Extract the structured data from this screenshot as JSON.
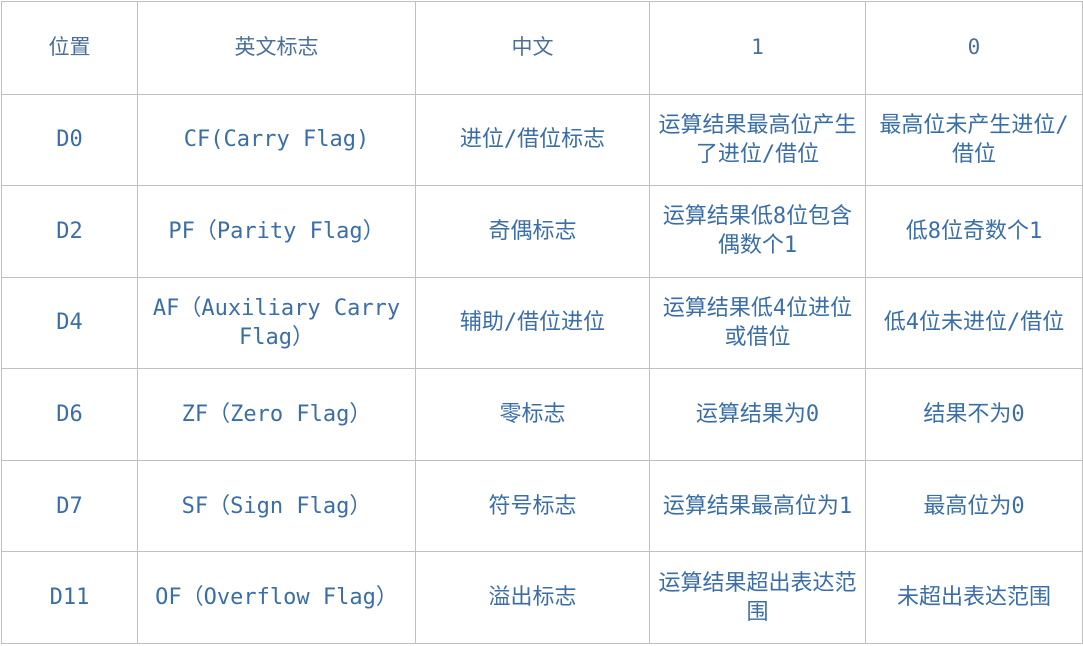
{
  "table": {
    "headers": [
      "位置",
      "英文标志",
      "中文",
      "1",
      "0"
    ],
    "rows": [
      {
        "position": "D0",
        "english": "CF(Carry Flag)",
        "chinese": "进位/借位标志",
        "when_one": "运算结果最高位产生了进位/借位",
        "when_zero": "最高位未产生进位/借位"
      },
      {
        "position": "D2",
        "english": "PF（Parity Flag）",
        "chinese": "奇偶标志",
        "when_one": "运算结果低8位包含偶数个1",
        "when_zero": "低8位奇数个1"
      },
      {
        "position": "D4",
        "english": "AF（Auxiliary Carry Flag）",
        "chinese": "辅助/借位进位",
        "when_one": "运算结果低4位进位或借位",
        "when_zero": "低4位未进位/借位"
      },
      {
        "position": "D6",
        "english": "ZF（Zero Flag）",
        "chinese": "零标志",
        "when_one": "运算结果为0",
        "when_zero": "结果不为0"
      },
      {
        "position": "D7",
        "english": "SF（Sign Flag）",
        "chinese": "符号标志",
        "when_one": "运算结果最高位为1",
        "when_zero": "最高位为0"
      },
      {
        "position": "D11",
        "english": "OF（Overflow Flag）",
        "chinese": "溢出标志",
        "when_one": "运算结果超出表达范围",
        "when_zero": "未超出表达范围"
      }
    ]
  }
}
